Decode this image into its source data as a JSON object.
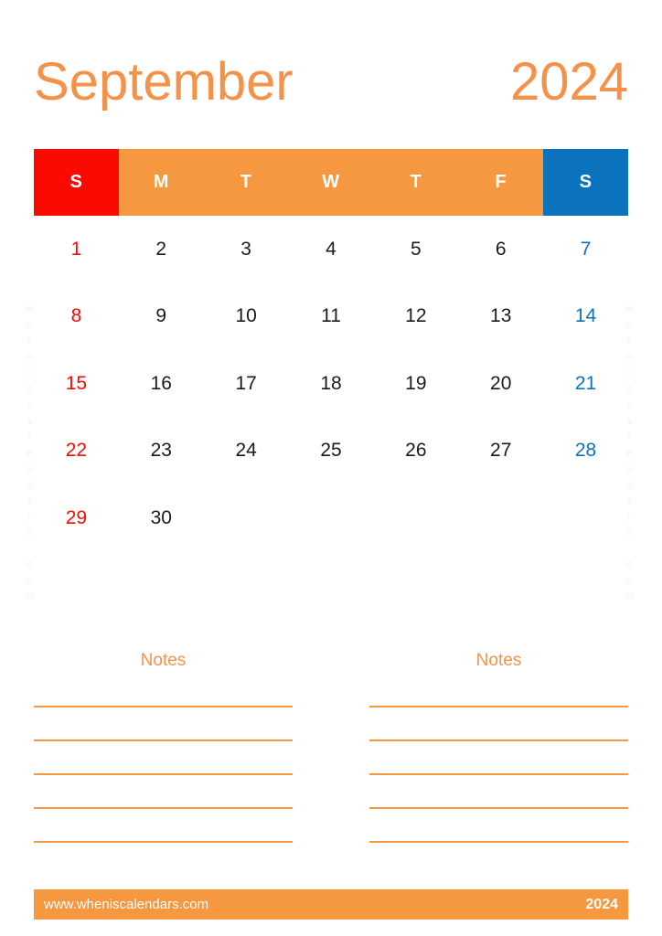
{
  "header": {
    "month": "September",
    "year": "2024"
  },
  "calendar": {
    "weekday_labels": [
      "S",
      "M",
      "T",
      "W",
      "T",
      "F",
      "S"
    ],
    "weekday_kinds": [
      "sun",
      "wd",
      "wd",
      "wd",
      "wd",
      "wd",
      "sat"
    ],
    "weeks": [
      [
        "1",
        "2",
        "3",
        "4",
        "5",
        "6",
        "7"
      ],
      [
        "8",
        "9",
        "10",
        "11",
        "12",
        "13",
        "14"
      ],
      [
        "15",
        "16",
        "17",
        "18",
        "19",
        "20",
        "21"
      ],
      [
        "22",
        "23",
        "24",
        "25",
        "26",
        "27",
        "28"
      ],
      [
        "29",
        "30",
        "",
        "",
        "",
        "",
        ""
      ]
    ]
  },
  "notes": {
    "left_title": "Notes",
    "right_title": "Notes",
    "line_count": 5
  },
  "footer": {
    "url": "www.wheniscalendars.com",
    "year": "2024"
  },
  "watermark": {
    "text": "wheniscalendars.com"
  },
  "colors": {
    "orange": "#F5983F",
    "title_orange": "#F5924A",
    "sunday_red": "#FA0A00",
    "saturday_blue": "#0B72BE",
    "weekday_text": "#1b1b1b",
    "header_text": "#FFFFFF",
    "watermark": "#F2F2F2",
    "background": "#FFFFFF"
  }
}
